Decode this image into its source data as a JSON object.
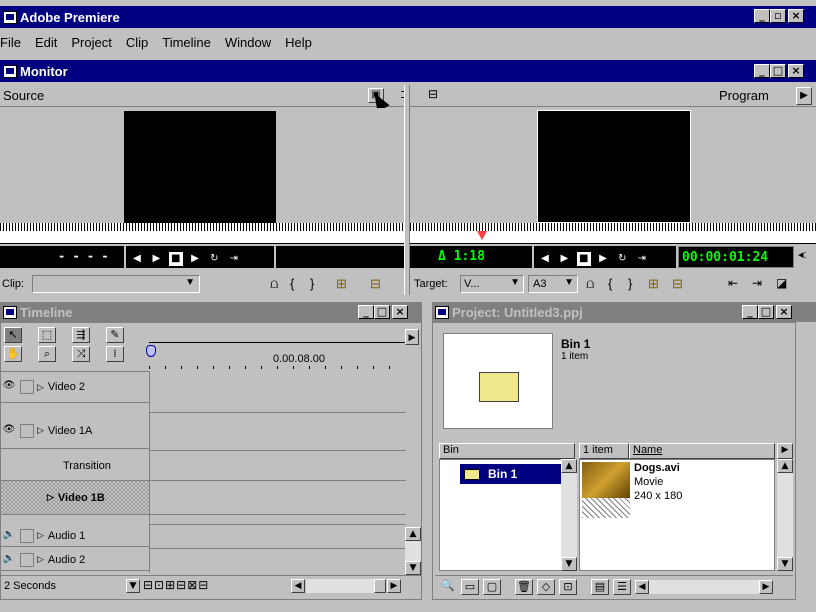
{
  "app": {
    "title": "Adobe Premiere"
  },
  "menu": [
    "File",
    "Edit",
    "Project",
    "Clip",
    "Timeline",
    "Window",
    "Help"
  ],
  "monitor": {
    "title": "Monitor",
    "source_label": "Source",
    "program_label": "Program",
    "source_timecode": "- - - -",
    "delta_timecode": "Δ 1:18",
    "program_timecode": "00:00:01:24",
    "clip_label": "Clip:",
    "target_label": "Target:",
    "target_video": "V...",
    "target_audio": "A3"
  },
  "timeline": {
    "title": "Timeline",
    "ruler_time": "0.00.08.00",
    "tracks": [
      "Video 2",
      "Video 1A",
      "Transition",
      "Video 1B",
      "Audio 1",
      "Audio 2"
    ],
    "time_unit": "2 Seconds"
  },
  "project": {
    "title": "Project: Untitled3.ppj",
    "bin_name": "Bin 1",
    "bin_count": "1 item",
    "col_bin": "Bin",
    "col_count": "1 item",
    "col_name": "Name",
    "bin_list_item": "Bin 1",
    "clip_name": "Dogs.avi",
    "clip_type": "Movie",
    "clip_size": "240 x 180"
  },
  "colors": {
    "title_active": "#000080",
    "title_inactive": "#808080",
    "face": "#c0c0c0",
    "timecode": "#00ff00"
  }
}
